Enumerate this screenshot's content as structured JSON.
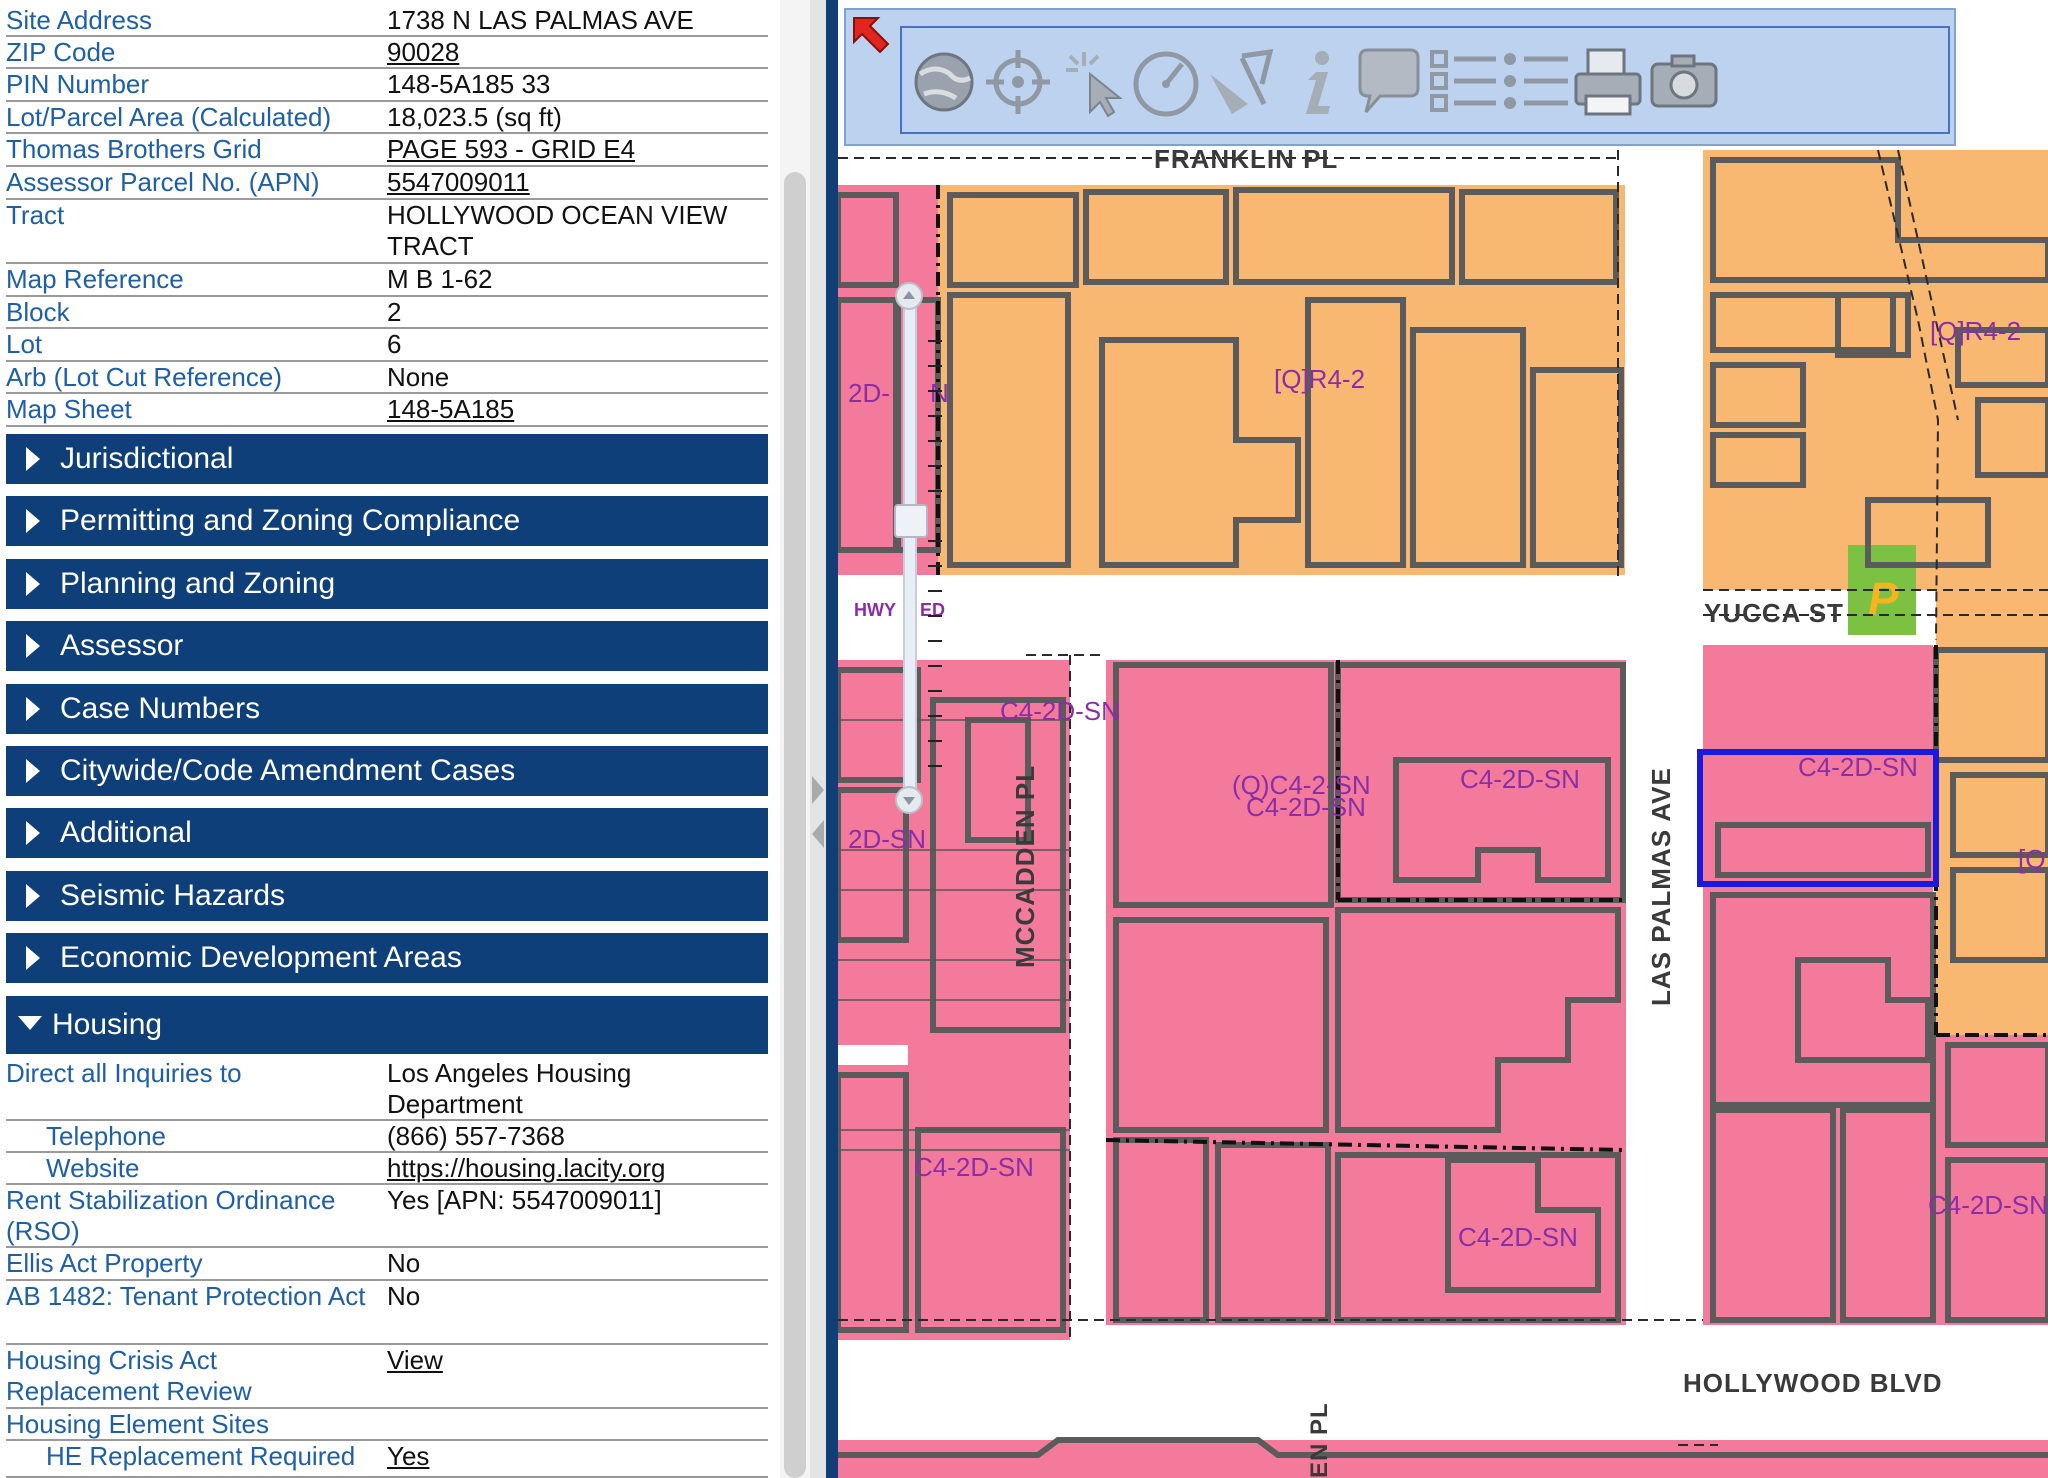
{
  "property_rows": [
    {
      "label": "Site Address",
      "value": "1738 N LAS PALMAS AVE"
    },
    {
      "label": "ZIP Code",
      "value": "90028",
      "link": true
    },
    {
      "label": "PIN Number",
      "value": "148-5A185  33"
    },
    {
      "label": "Lot/Parcel Area (Calculated)",
      "value": "18,023.5 (sq ft)"
    },
    {
      "label": "Thomas Brothers Grid",
      "value": "PAGE 593 - GRID E4",
      "link": true
    },
    {
      "label": "Assessor Parcel No. (APN)",
      "value": "5547009011",
      "link": true
    },
    {
      "label": "Tract",
      "value": "HOLLYWOOD OCEAN VIEW TRACT"
    },
    {
      "label": "Map Reference",
      "value": "M B 1-62"
    },
    {
      "label": "Block",
      "value": "2"
    },
    {
      "label": "Lot",
      "value": "6"
    },
    {
      "label": "Arb (Lot Cut Reference)",
      "value": "None"
    },
    {
      "label": "Map Sheet",
      "value": "148-5A185",
      "link": true
    }
  ],
  "sections": [
    {
      "label": "Jurisdictional"
    },
    {
      "label": "Permitting and Zoning Compliance"
    },
    {
      "label": "Planning and Zoning"
    },
    {
      "label": "Assessor"
    },
    {
      "label": "Case Numbers"
    },
    {
      "label": "Citywide/Code Amendment Cases"
    },
    {
      "label": "Additional"
    },
    {
      "label": "Seismic Hazards"
    },
    {
      "label": "Economic Development Areas"
    }
  ],
  "housing": {
    "label": "Housing",
    "rows": [
      {
        "label": "Direct all Inquiries to",
        "value": "Los Angeles Housing Department"
      },
      {
        "label": "Telephone",
        "value": "(866) 557-7368",
        "indent": true
      },
      {
        "label": "Website",
        "value": "https://housing.lacity.org",
        "indent": true,
        "link": true
      },
      {
        "label": "Rent Stabilization Ordinance (RSO)",
        "value": "Yes [APN: 5547009011]"
      },
      {
        "label": "Ellis Act Property",
        "value": "No"
      },
      {
        "label": "AB 1482: Tenant Protection Act",
        "value": "No"
      },
      {
        "label": "Housing Crisis Act Replacement Review",
        "value": "View",
        "link": true
      },
      {
        "label": "Housing Element Sites",
        "value": ""
      },
      {
        "label": "HE Replacement Required",
        "value": "Yes",
        "indent": true,
        "link": true
      }
    ]
  },
  "toolbar": {
    "tools": [
      "globe-icon",
      "crosshair-icon",
      "select-icon",
      "measure-icon",
      "drawing-icon",
      "info-icon",
      "comment-icon",
      "checklist-icon",
      "list-icon",
      "print-icon",
      "camera-icon"
    ]
  },
  "map": {
    "streets": {
      "franklin": "FRANKLIN PL",
      "yucca": "YUCCA ST",
      "mccadden": "MCCADDEN PL",
      "las_palmas": "LAS PALMAS AVE",
      "hollywood": "HOLLYWOOD BLVD",
      "hwy": "HWY",
      "ed": "ED",
      "en_pl": "EN PL"
    },
    "zones": {
      "qr42_a": "[Q]R4-2",
      "qr42_b": "[Q]R4-2",
      "c42dsn_1": "C4-2D-SN",
      "qc42sn": "(Q)C4-2-SN",
      "c42dsn_2": "C4-2D-SN",
      "c42dsn_3": "C4-2D-SN",
      "c42dsn_4": "C4-2D-SN",
      "c42dsn_5": "C4-2D-SN",
      "c42dsn_6": "C4-2D-SN",
      "c42dsn_7": "C4-2D-SN",
      "c42dsn_left": "2D-SN",
      "c42dsn_left2": "2D-",
      "n_left": "N",
      "q_right": "[Q"
    },
    "colors": {
      "residential": "#f8b872",
      "commercial": "#f47a9c",
      "selection": "#1a1adb",
      "parking": "#7dc142"
    }
  }
}
